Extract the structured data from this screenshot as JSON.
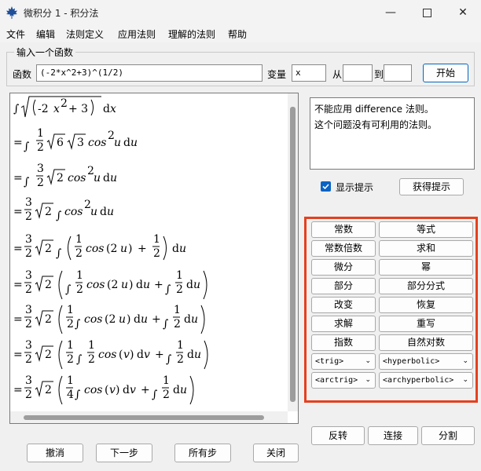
{
  "window": {
    "title": "微积分 1 - 积分法"
  },
  "menu": [
    "文件",
    "编辑",
    "法则定义",
    "应用法则",
    "理解的法则",
    "帮助"
  ],
  "input": {
    "group_title": "输入一个函数",
    "function_label": "函数",
    "function_value": "(-2*x^2+3)^(1/2)",
    "variable_label": "变量",
    "variable_value": "x",
    "from_label": "从",
    "to_label": "到",
    "from_value": "",
    "to_value": "",
    "start_button": "开始"
  },
  "steps": [
    {
      "eq": "",
      "coef": "",
      "content": "∫√(−2x² + 3) dx"
    },
    {
      "eq": "=",
      "coef": "",
      "content": "∫ 1/2 √6 √3 cos²u du"
    },
    {
      "eq": "=",
      "coef": "",
      "content": "∫ 3/2 √2 cos²u du"
    },
    {
      "eq": "=",
      "coef": "3/2 √2",
      "content": "∫ cos²u du"
    },
    {
      "eq": "=",
      "coef": "3/2 √2",
      "content": "∫ (1/2 cos(2u) + 1/2) du"
    },
    {
      "eq": "=",
      "coef": "3/2 √2",
      "content": "(∫ 1/2 cos(2u) du + ∫ 1/2 du)"
    },
    {
      "eq": "=",
      "coef": "3/2 √2",
      "content": "(1/2 ∫cos(2u) du + ∫ 1/2 du)"
    },
    {
      "eq": "=",
      "coef": "3/2 √2",
      "content": "(1/2 ∫ 1/2 cos(v) dv + ∫ 1/2 du)"
    },
    {
      "eq": "=",
      "coef": "3/2 √2",
      "content": "(1/4 ∫cos(v) dv + ∫ 1/2 du)"
    }
  ],
  "hint": {
    "line1": "不能应用 difference 法则。",
    "line2": "这个问题没有可利用的法则。"
  },
  "show_hint": {
    "label": "显示提示",
    "checked": true
  },
  "get_hint_button": "获得提示",
  "rules": {
    "buttons": [
      "常数",
      "等式",
      "常数倍数",
      "求和",
      "微分",
      "幂",
      "部分",
      "部分分式",
      "改变",
      "恢复",
      "求解",
      "重写",
      "指数",
      "自然对数"
    ],
    "selects": [
      "<trig>",
      "<hyperbolic>",
      "<arctrig>",
      "<archyperbolic>"
    ]
  },
  "transform_buttons": [
    "反转",
    "连接",
    "分割"
  ],
  "bottom_buttons": [
    "撤消",
    "下一步",
    "所有步",
    "关闭"
  ],
  "colors": {
    "highlight_border": "#e5401f",
    "checkbox": "#0b63c4"
  }
}
